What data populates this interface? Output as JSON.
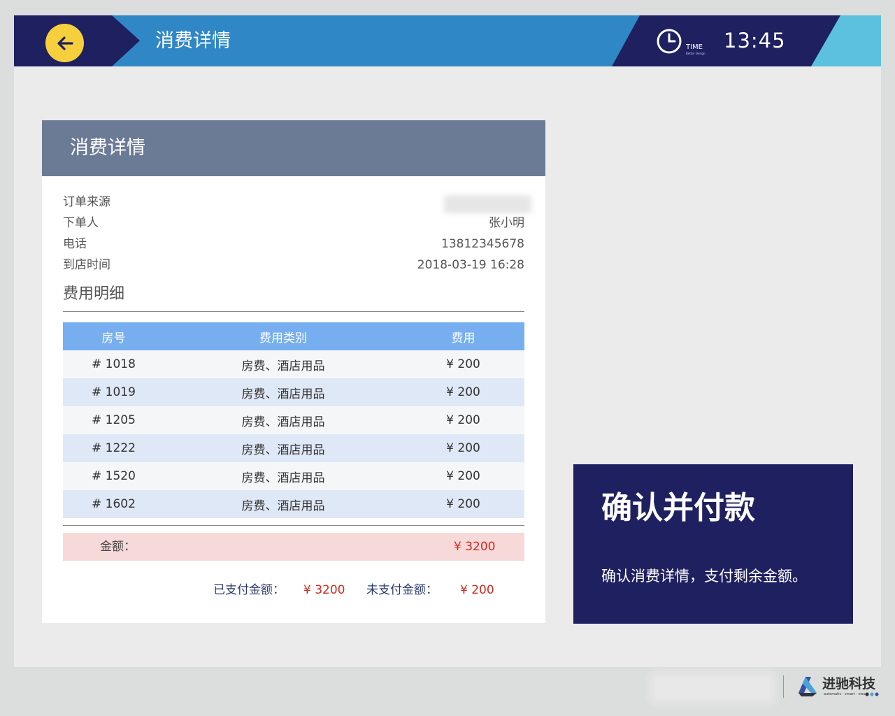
{
  "header": {
    "title": "消费详情",
    "time_label": "TIME",
    "time_sublabel": "Better Design",
    "time": "13:45"
  },
  "card": {
    "title": "消费详情",
    "info": [
      {
        "label": "订单来源",
        "value": ""
      },
      {
        "label": "下单人",
        "value": "张小明"
      },
      {
        "label": "电话",
        "value": "13812345678"
      },
      {
        "label": "到店时间",
        "value": "2018-03-19  16:28"
      }
    ],
    "section_title": "费用明细",
    "table": {
      "headers": [
        "房号",
        "费用类别",
        "费用"
      ],
      "rows": [
        [
          "# 1018",
          "房费、酒店用品",
          "¥ 200"
        ],
        [
          "# 1019",
          "房费、酒店用品",
          "¥ 200"
        ],
        [
          "# 1205",
          "房费、酒店用品",
          "¥ 200"
        ],
        [
          "# 1222",
          "房费、酒店用品",
          "¥ 200"
        ],
        [
          "# 1520",
          "房费、酒店用品",
          "¥ 200"
        ],
        [
          "# 1602",
          "房费、酒店用品",
          "¥ 200"
        ]
      ]
    },
    "total_label": "金额：",
    "total_value": "¥ 3200",
    "paid_label": "已支付金额：",
    "paid_value": "¥ 3200",
    "unpaid_label": "未支付金额：",
    "unpaid_value": "¥ 200"
  },
  "confirm": {
    "title": "确认并付款",
    "description": "确认消费详情，支付剩余金额。"
  },
  "footer": {
    "brand": "进驰科技",
    "tagline": "automatic · smart · visual"
  },
  "colors": {
    "navy": "#1f2060",
    "blue": "#2f87c6",
    "accent": "#f6cf3c",
    "table_head": "#77aeef",
    "price_red": "#d02a1e"
  },
  "icons": {
    "back": "arrow-left-icon",
    "clock": "clock-icon"
  }
}
